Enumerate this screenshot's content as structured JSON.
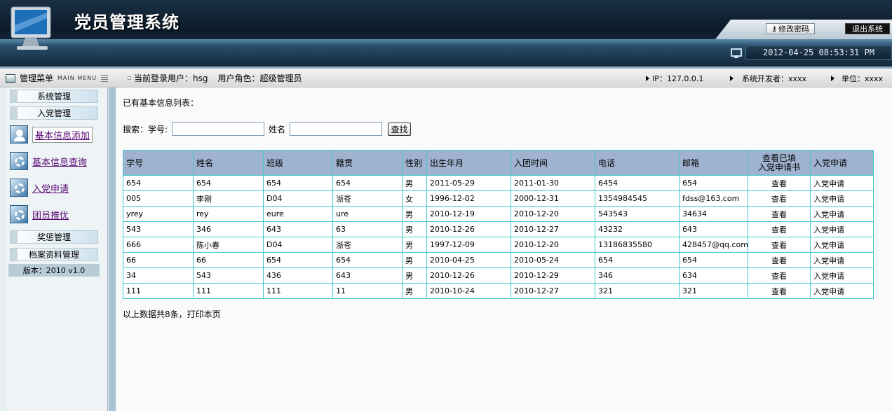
{
  "header": {
    "title": "党员管理系统",
    "change_password": "修改密码",
    "logout": "退出系统",
    "datetime": "2012-04-25 08:53:31 PM"
  },
  "infobar": {
    "menu_label": "管理菜单",
    "menu_sub": "MAIN MENU",
    "user_label": "当前登录用户：hsg",
    "role_label": "用户角色：超级管理员",
    "ip": "IP：127.0.0.1",
    "developer": "系统开发者：xxxx",
    "unit": "单位：xxxx"
  },
  "sidebar": {
    "section_system": "系统管理",
    "section_join": "入党管理",
    "items": [
      {
        "label": "基本信息添加",
        "icon": "user-add-icon"
      },
      {
        "label": "基本信息查询",
        "icon": "gear-icon"
      },
      {
        "label": "入党申请",
        "icon": "gear-icon"
      },
      {
        "label": "团员推优",
        "icon": "gear-icon"
      }
    ],
    "section_reward": "奖惩管理",
    "section_archive": "档案资料管理",
    "version": "版本：2010 v1.0"
  },
  "content": {
    "list_title": "已有基本信息列表：",
    "search_label": "搜索：学号:",
    "name_label": "姓名",
    "search_button": "查找",
    "student_id_value": "",
    "name_value": "",
    "footer": "以上数据共8条，打印本页"
  },
  "table": {
    "headers": [
      "学号",
      "姓名",
      "班级",
      "籍贯",
      "性别",
      "出生年月",
      "入团时间",
      "电话",
      "邮箱",
      "查看已填",
      "入党申请书",
      "入党申请"
    ],
    "rows": [
      [
        "654",
        "654",
        "654",
        "654",
        "男",
        "2011-05-29",
        "2011-01-30",
        "6454",
        "654",
        "查看",
        "入党申请"
      ],
      [
        "005",
        "李刚",
        "D04",
        "浙苍",
        "女",
        "1996-12-02",
        "2000-12-31",
        "1354984545",
        "fdss@163.com",
        "查看",
        "入党申请"
      ],
      [
        "yrey",
        "rey",
        "eure",
        "ure",
        "男",
        "2010-12-19",
        "2010-12-20",
        "543543",
        "34634",
        "查看",
        "入党申请"
      ],
      [
        "543",
        "346",
        "643",
        "63",
        "男",
        "2010-12-26",
        "2010-12-27",
        "43232",
        "643",
        "查看",
        "入党申请"
      ],
      [
        "666",
        "陈小春",
        "D04",
        "浙苍",
        "男",
        "1997-12-09",
        "2010-12-20",
        "13186835580",
        "428457@qq.com",
        "查看",
        "入党申请"
      ],
      [
        "66",
        "66",
        "654",
        "654",
        "男",
        "2010-04-25",
        "2010-05-24",
        "654",
        "654",
        "查看",
        "入党申请"
      ],
      [
        "34",
        "543",
        "436",
        "643",
        "男",
        "2010-12-26",
        "2010-12-29",
        "346",
        "634",
        "查看",
        "入党申请"
      ],
      [
        "111",
        "111",
        "111",
        "11",
        "男",
        "2010-10-24",
        "2010-12-27",
        "321",
        "321",
        "查看",
        "入党申请"
      ]
    ]
  },
  "colors": {
    "header_bg": "#0b1a2a",
    "table_header_bg": "#9fb2cf",
    "table_border": "#43c7cf",
    "link_color": "#5a0a74"
  }
}
